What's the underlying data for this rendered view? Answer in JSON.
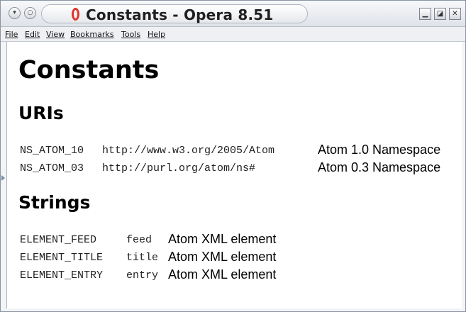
{
  "window": {
    "title": "Constants - Opera 8.51",
    "title_icon": "opera-icon",
    "left_buttons": [
      "menu-icon",
      "pin-icon"
    ],
    "right_buttons": [
      "minimize-icon",
      "maximize-icon",
      "close-icon"
    ]
  },
  "menu": {
    "items": [
      "File",
      "Edit",
      "View",
      "Bookmarks",
      "Tools",
      "Help"
    ]
  },
  "page": {
    "heading": "Constants",
    "uris_heading": "URIs",
    "uris": [
      {
        "name": "NS_ATOM_10",
        "value": "http://www.w3.org/2005/Atom",
        "desc": "Atom 1.0 Namespace"
      },
      {
        "name": "NS_ATOM_03",
        "value": "http://purl.org/atom/ns#",
        "desc": "Atom 0.3 Namespace"
      }
    ],
    "strings_heading": "Strings",
    "strings": [
      {
        "name": "ELEMENT_FEED",
        "value": "feed",
        "desc": "Atom XML element"
      },
      {
        "name": "ELEMENT_TITLE",
        "value": "title",
        "desc": "Atom XML element"
      },
      {
        "name": "ELEMENT_ENTRY",
        "value": "entry",
        "desc": "Atom XML element"
      }
    ]
  },
  "colors": {
    "opera_red": "#e0342a",
    "window_border": "#8a93a3"
  }
}
